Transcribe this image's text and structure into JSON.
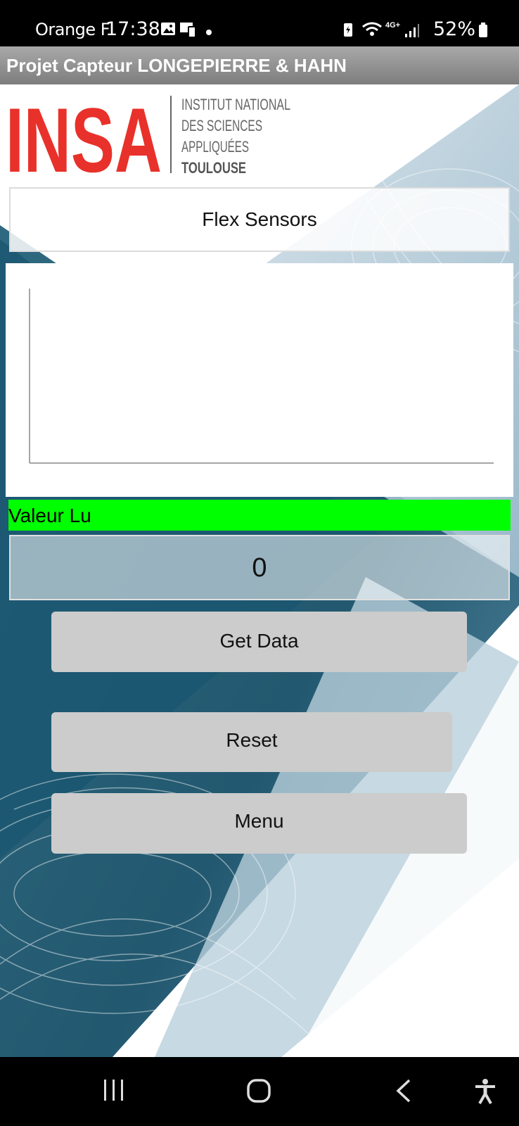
{
  "status_bar": {
    "carrier": "Orange F",
    "time": "17:38",
    "network": "4G+",
    "battery": "52%"
  },
  "app": {
    "title": "Projet Capteur LONGEPIERRE & HAHN",
    "logo": {
      "wordmark": "INSA",
      "line1": "INSTITUT NATIONAL",
      "line2": "DES SCIENCES",
      "line3": "APPLIQUÉES",
      "line4": "TOULOUSE"
    },
    "sensor_title": "Flex Sensors",
    "reading_label": "Valeur Lu",
    "reading_value": "0",
    "buttons": {
      "get_data": "Get Data",
      "reset": "Reset",
      "menu": "Menu"
    }
  },
  "colors": {
    "accent_green": "#00ff00",
    "button_gray": "#cccccc",
    "insa_red": "#e8312a"
  }
}
